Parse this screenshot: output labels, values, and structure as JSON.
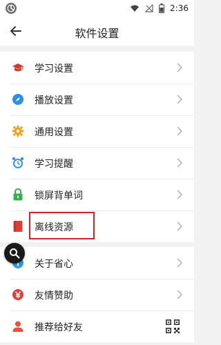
{
  "status_bar": {
    "time": "2:36",
    "icons": [
      "wifi-icon",
      "signal-off-icon",
      "battery-icon"
    ]
  },
  "header": {
    "title": "软件设置",
    "back_icon": "back-arrow-icon"
  },
  "colors": {
    "accent_red": "#c9252b",
    "divider": "#ececec",
    "background": "#f2f2f2"
  },
  "menu_group_1": [
    {
      "label": "学习设置",
      "icon": "graduation-cap-icon"
    },
    {
      "label": "播放设置",
      "icon": "compass-icon"
    },
    {
      "label": "通用设置",
      "icon": "gear-icon"
    },
    {
      "label": "学习提醒",
      "icon": "alarm-clock-icon"
    },
    {
      "label": "锁屏背单词",
      "icon": "lock-icon"
    },
    {
      "label": "离线资源",
      "icon": "book-icon"
    }
  ],
  "menu_group_2": [
    {
      "label": "关于省心",
      "icon": "info-icon"
    },
    {
      "label": "友情赞助",
      "icon": "yen-icon"
    },
    {
      "label": "推荐给好友",
      "icon": "user-icon"
    }
  ],
  "overlay": {
    "search_icon": "magnifier-icon",
    "qr_icon": "qr-code-icon"
  }
}
